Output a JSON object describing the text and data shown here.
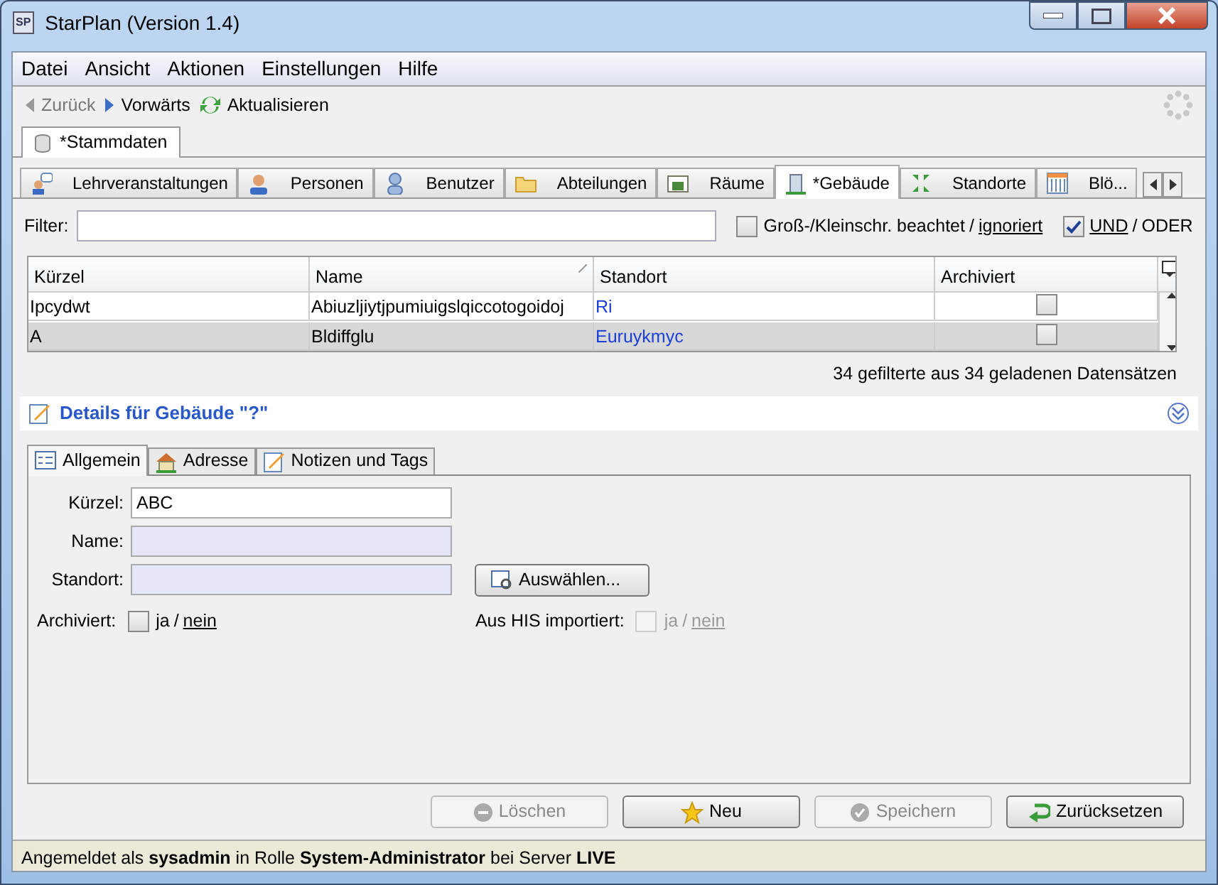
{
  "window": {
    "logo": "SP",
    "title": "StarPlan (Version 1.4)"
  },
  "menu": [
    "Datei",
    "Ansicht",
    "Aktionen",
    "Einstellungen",
    "Hilfe"
  ],
  "toolbar": [
    {
      "label": "Zurück",
      "disabled": true
    },
    {
      "label": "Vorwärts",
      "disabled": false
    },
    {
      "label": "Aktualisieren",
      "disabled": false
    }
  ],
  "document_tabs": [
    {
      "label": "*Stammdaten",
      "selected": true
    }
  ],
  "module_tabs": [
    {
      "label": "Lehrveranstaltungen",
      "selected": false
    },
    {
      "label": "Personen",
      "selected": false
    },
    {
      "label": "Benutzer",
      "selected": false
    },
    {
      "label": "Abteilungen",
      "selected": false
    },
    {
      "label": "Räume",
      "selected": false
    },
    {
      "label": "*Gebäude",
      "selected": true
    },
    {
      "label": "Standorte",
      "selected": false
    },
    {
      "label": "Blö...",
      "selected": false
    }
  ],
  "filter": {
    "label": "Filter:",
    "case_option": {
      "checked": false,
      "separator": "/",
      "options": [
        {
          "label": "Groß-/Kleinschr. beachtet",
          "selected": false
        },
        {
          "label": "ignoriert",
          "selected": true
        }
      ]
    },
    "logic_option": {
      "checked": true,
      "separator": "/",
      "options": [
        {
          "label": "UND",
          "selected": true
        },
        {
          "label": "ODER",
          "selected": false
        }
      ]
    }
  },
  "table": {
    "columns": [
      "Kürzel",
      "Name",
      "Standort",
      "Archiviert"
    ],
    "rows": [
      {
        "kuerzel": "Ipcydwt",
        "name": "Abiuzljiytjpumiuigslqiccotogoidoj",
        "standort": "Ri",
        "archived": false,
        "selected": false
      },
      {
        "kuerzel": "A",
        "name": "Bldiffglu",
        "standort": "Euruykmyc",
        "archived": false,
        "selected": true
      }
    ]
  },
  "record_count": "34 gefilterte aus 34 geladenen Datensätzen",
  "details": {
    "title": "Details für Gebäude \"?\"",
    "expanded": false,
    "tabs": [
      {
        "label": "Allgemein",
        "selected": true
      },
      {
        "label": "Adresse",
        "selected": false
      },
      {
        "label": "Notizen und Tags",
        "selected": false
      }
    ],
    "fields": [
      {
        "label": "Kürzel:",
        "value": "ABC",
        "required": false
      },
      {
        "label": "Name:",
        "required": true
      },
      {
        "label": "Standort:",
        "required": true
      }
    ],
    "select_button": "Auswählen...",
    "archived": {
      "label": "Archiviert:",
      "checked": false,
      "disabled": false,
      "separator": "/",
      "options": [
        {
          "label": "ja",
          "selected": false
        },
        {
          "label": "nein",
          "selected": true
        }
      ]
    },
    "his_imported": {
      "label": "Aus HIS importiert:",
      "checked": false,
      "disabled": true,
      "separator": "/",
      "options": [
        {
          "label": "ja",
          "selected": false
        },
        {
          "label": "nein",
          "selected": true
        }
      ]
    }
  },
  "buttons": [
    {
      "label": "Löschen",
      "disabled": true
    },
    {
      "label": "Neu",
      "disabled": false
    },
    {
      "label": "Speichern",
      "disabled": true
    },
    {
      "label": "Zurücksetzen",
      "disabled": false
    }
  ],
  "status_bar": "Angemeldet als **sysadmin** in Rolle **System-Administrator** bei Server **LIVE**"
}
